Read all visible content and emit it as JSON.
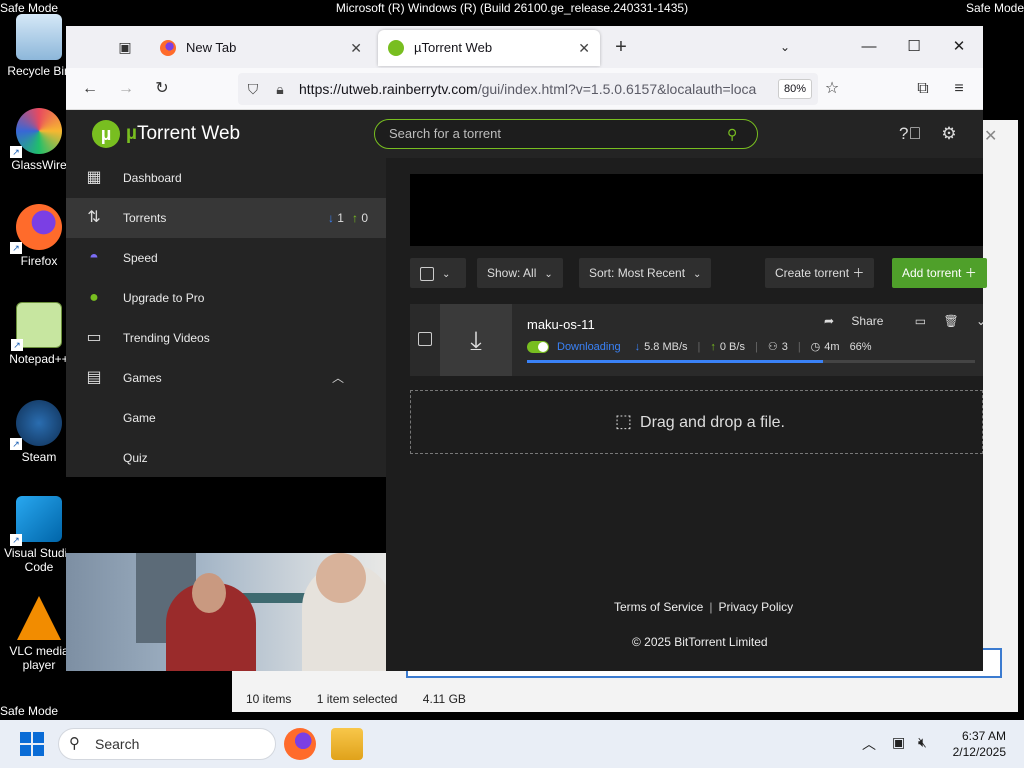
{
  "desktop": {
    "os_title": "Microsoft (R) Windows (R) (Build 26100.ge_release.240331-1435)",
    "safe_mode": "Safe Mode",
    "icons": [
      {
        "label": "Recycle Bin",
        "icon": "recycle-bin-icon"
      },
      {
        "label": "GlassWire",
        "icon": "glasswire-icon"
      },
      {
        "label": "Firefox",
        "icon": "firefox-icon"
      },
      {
        "label": "Notepad++",
        "icon": "notepad-plus-plus-icon"
      },
      {
        "label": "Steam",
        "icon": "steam-icon"
      },
      {
        "label": "Visual Studio Code",
        "icon": "vscode-icon"
      },
      {
        "label": "VLC media player",
        "icon": "vlc-icon"
      }
    ]
  },
  "explorer_window": {
    "status": {
      "items": "10 items",
      "selected": "1 item selected",
      "size": "4.11 GB"
    }
  },
  "browser": {
    "tabs": [
      {
        "label": "New Tab",
        "active": false
      },
      {
        "label": "µTorrent Web",
        "active": true
      }
    ],
    "url_host": "https://utweb.rainberrytv.com",
    "url_path": "/gui/index.html?v=1.5.0.6157&localauth=loca",
    "zoom": "80%"
  },
  "app": {
    "logo_mu": "µ",
    "logo_text": "Torrent Web",
    "search_placeholder": "Search for a torrent",
    "nav": [
      {
        "label": "Dashboard",
        "icon": "dashboard-icon"
      },
      {
        "label": "Torrents",
        "icon": "torrents-icon",
        "down_count": "1",
        "up_count": "0"
      },
      {
        "label": "Speed",
        "icon": "speed-icon"
      },
      {
        "label": "Upgrade to Pro",
        "icon": "utorrent-pro-icon"
      },
      {
        "label": "Trending Videos",
        "icon": "trending-videos-icon"
      },
      {
        "label": "Games",
        "icon": "games-icon"
      },
      {
        "label": "Game"
      },
      {
        "label": "Quiz"
      }
    ],
    "toolbar": {
      "show_label": "Show:",
      "show_value": "All",
      "sort_label": "Sort:",
      "sort_value": "Most Recent",
      "create_label": "Create torrent",
      "add_label": "Add torrent"
    },
    "torrent": {
      "name": "maku-os-11",
      "status": "Downloading",
      "down_speed": "5.8 MB/s",
      "up_speed": "0 B/s",
      "peers": "3",
      "eta": "4m",
      "percent_label": "66%",
      "progress": 0.66,
      "share_label": "Share"
    },
    "dropzone_text": "Drag and drop a file.",
    "footer": {
      "terms": "Terms of Service",
      "privacy": "Privacy Policy",
      "copyright": "© 2025 BitTorrent Limited"
    }
  },
  "taskbar": {
    "search_placeholder": "Search",
    "time": "6:37 AM",
    "date": "2/12/2025"
  },
  "colors": {
    "accent_green": "#78be20",
    "download_blue": "#3a82f7",
    "app_bg": "#1d1d1d"
  }
}
